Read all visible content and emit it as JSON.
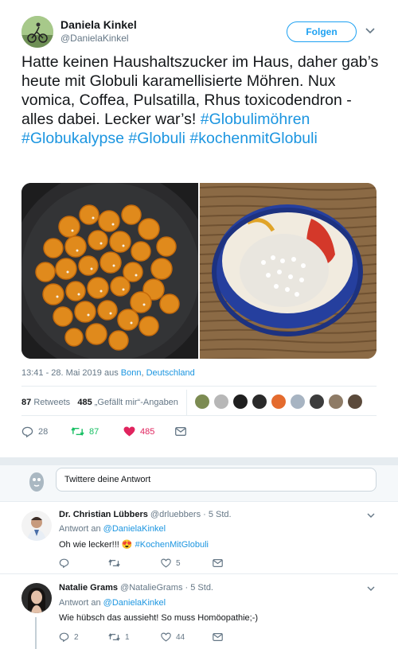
{
  "author": {
    "name": "Daniela Kinkel",
    "handle": "@DanielaKinkel",
    "follow_label": "Folgen"
  },
  "tweet": {
    "text": "Hatte keinen Haushaltszucker im Haus, daher gab’s heute mit Globuli karamellisierte Möhren. Nux vomica, Coffea, Pulsatilla, Rhus toxicodendron - alles dabei. Lecker war’s!",
    "hashtags": [
      "#Globulimöhren",
      "#Globukalypse",
      "#Globuli",
      "#kochenmitGlobuli"
    ],
    "time": "13:41 - 28. Mai 2019 aus",
    "loc_city": "Bonn",
    "loc_sep": ",",
    "loc_country": "Deutschland"
  },
  "stats": {
    "retweets_count": "87",
    "retweets_label": "Retweets",
    "likes_count": "485",
    "likes_label": "„Gefällt mir“-Angaben"
  },
  "actions": {
    "replies": "28",
    "retweets": "87",
    "likes": "485"
  },
  "reply_box": {
    "placeholder": "Twittere deine Antwort"
  },
  "replies": [
    {
      "name": "Dr. Christian Lübbers",
      "handle": "@drluebbers",
      "time": "· 5 Std.",
      "to_prefix": "Antwort an",
      "to_handle": "@DanielaKinkel",
      "text": "Oh wie lecker!!!",
      "emoji": "😍",
      "hashtag": "#KochenMitGlobuli",
      "reply_count": "",
      "retweet_count": "",
      "like_count": "5"
    },
    {
      "name": "Natalie Grams",
      "handle": "@NatalieGrams",
      "time": "· 5 Std.",
      "to_prefix": "Antwort an",
      "to_handle": "@DanielaKinkel",
      "text": "Wie hübsch das aussieht! So muss Homöopathie;-)",
      "reply_count": "2",
      "retweet_count": "1",
      "like_count": "44"
    }
  ],
  "colors": {
    "accent": "#1da1f2",
    "link": "#1b95e0",
    "like": "#e0245e",
    "retweet": "#17bf63",
    "muted": "#657786"
  }
}
